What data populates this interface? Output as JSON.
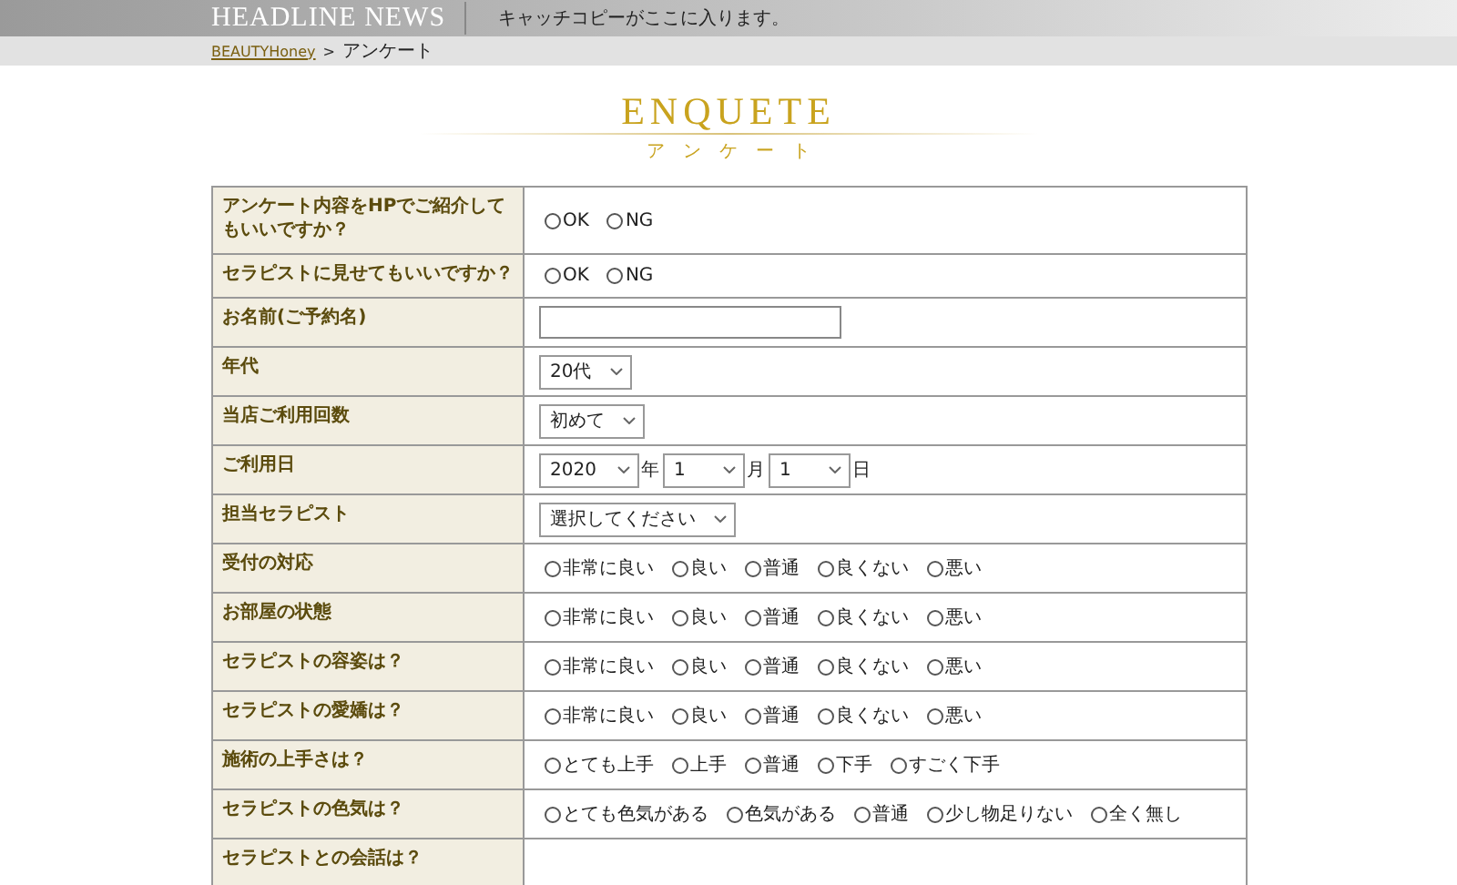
{
  "header": {
    "title": "HEADLINE NEWS",
    "catchcopy": "キャッチコピーがここに入ります。"
  },
  "breadcrumb": {
    "link": "BEAUTYHoney",
    "separator": ">",
    "current": "アンケート"
  },
  "heading": {
    "title": "ENQUETE",
    "subtitle": "アンケート"
  },
  "rows": [
    {
      "label": "アンケート内容をHPでご紹介してもいいですか？",
      "kind": "radio",
      "options": [
        {
          "label": "OK",
          "selected": false
        },
        {
          "label": "NG",
          "selected": false
        }
      ]
    },
    {
      "label": "セラピストに見せてもいいですか？",
      "kind": "radio",
      "options": [
        {
          "label": "OK",
          "selected": false
        },
        {
          "label": "NG",
          "selected": false
        }
      ]
    },
    {
      "label": "お名前(ご予約名)",
      "kind": "text"
    },
    {
      "label": "年代",
      "kind": "select",
      "value": "20代"
    },
    {
      "label": "当店ご利用回数",
      "kind": "select",
      "value": "初めて"
    },
    {
      "label": "ご利用日",
      "kind": "date",
      "parts": [
        {
          "value": "2020",
          "unit": "年"
        },
        {
          "value": "1",
          "unit": "月"
        },
        {
          "value": "1",
          "unit": "日"
        }
      ]
    },
    {
      "label": "担当セラピスト",
      "kind": "select",
      "value": "選択してください"
    },
    {
      "label": "受付の対応",
      "kind": "radio",
      "options": [
        {
          "label": "非常に良い",
          "selected": false
        },
        {
          "label": "良い",
          "selected": false
        },
        {
          "label": "普通",
          "selected": false
        },
        {
          "label": "良くない",
          "selected": false
        },
        {
          "label": "悪い",
          "selected": false
        }
      ]
    },
    {
      "label": "お部屋の状態",
      "kind": "radio",
      "options": [
        {
          "label": "非常に良い",
          "selected": false
        },
        {
          "label": "良い",
          "selected": false
        },
        {
          "label": "普通",
          "selected": false
        },
        {
          "label": "良くない",
          "selected": false
        },
        {
          "label": "悪い",
          "selected": false
        }
      ]
    },
    {
      "label": "セラピストの容姿は？",
      "kind": "radio",
      "options": [
        {
          "label": "非常に良い",
          "selected": false
        },
        {
          "label": "良い",
          "selected": false
        },
        {
          "label": "普通",
          "selected": false
        },
        {
          "label": "良くない",
          "selected": false
        },
        {
          "label": "悪い",
          "selected": false
        }
      ]
    },
    {
      "label": "セラピストの愛嬌は？",
      "kind": "radio",
      "options": [
        {
          "label": "非常に良い",
          "selected": false
        },
        {
          "label": "良い",
          "selected": false
        },
        {
          "label": "普通",
          "selected": false
        },
        {
          "label": "良くない",
          "selected": false
        },
        {
          "label": "悪い",
          "selected": false
        }
      ]
    },
    {
      "label": "施術の上手さは？",
      "kind": "radio",
      "options": [
        {
          "label": "とても上手",
          "selected": false
        },
        {
          "label": "上手",
          "selected": false
        },
        {
          "label": "普通",
          "selected": false
        },
        {
          "label": "下手",
          "selected": false
        },
        {
          "label": "すごく下手",
          "selected": false
        }
      ]
    },
    {
      "label": "セラピストの色気は？",
      "kind": "radio",
      "options": [
        {
          "label": "とても色気がある",
          "selected": false
        },
        {
          "label": "色気がある",
          "selected": false
        },
        {
          "label": "普通",
          "selected": false
        },
        {
          "label": "少し物足りない",
          "selected": false
        },
        {
          "label": "全く無し",
          "selected": false
        }
      ]
    },
    {
      "label": "セラピストとの会話は？",
      "kind": "none"
    }
  ]
}
